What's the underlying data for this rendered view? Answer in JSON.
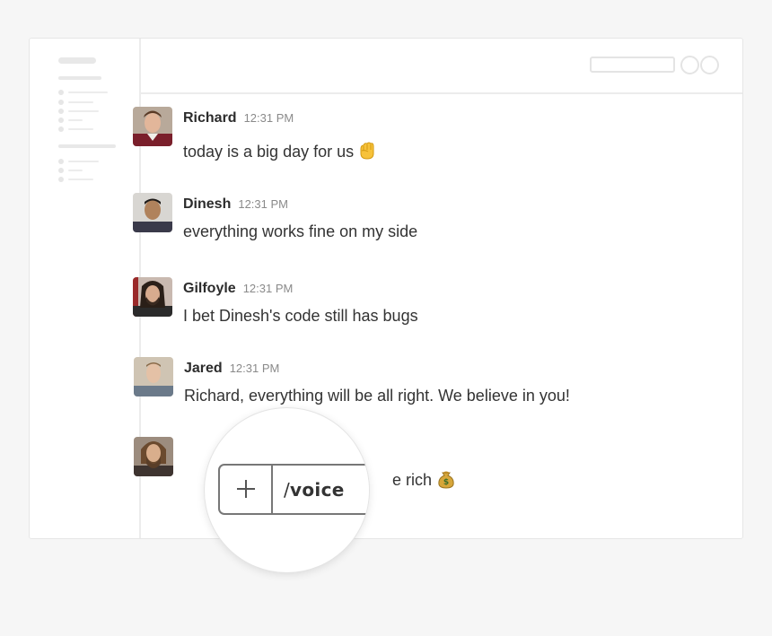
{
  "messages": [
    {
      "author": "Richard",
      "time": "12:31 PM",
      "text": "today is a big day for us",
      "emoji": "raised-fist"
    },
    {
      "author": "Dinesh",
      "time": "12:31 PM",
      "text": "everything works fine on my side"
    },
    {
      "author": "Gilfoyle",
      "time": "12:31 PM",
      "text": "I bet Dinesh's code still has bugs"
    },
    {
      "author": "Jared",
      "time": "12:31 PM",
      "text": "Richard, everything will be all right. We believe in you!"
    },
    {
      "author": "",
      "time": "",
      "text_visible": "e rich",
      "emoji": "money-bag"
    }
  ],
  "composer": {
    "slash": "/",
    "command": "voice"
  },
  "colors": {
    "background": "#f6f6f6",
    "window": "#ffffff",
    "border": "#ececec",
    "text": "#333333",
    "time": "#8a8a8a"
  }
}
